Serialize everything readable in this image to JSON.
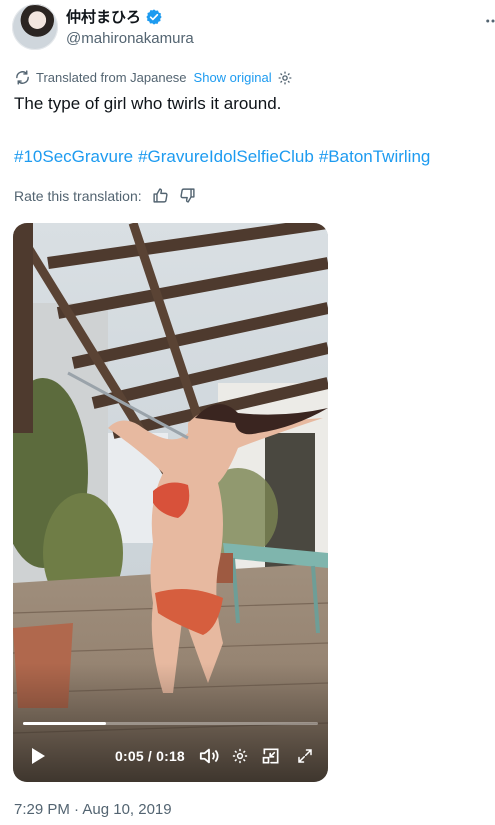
{
  "author": {
    "display_name": "仲村まひろ",
    "handle": "@mahironakamura",
    "verified": true,
    "icons": {
      "verified": "verified-badge-icon",
      "more": "more-dots-icon"
    }
  },
  "translation": {
    "prefix": "Translated from Japanese",
    "show_original": "Show original",
    "icons": {
      "translate": "translate-icon",
      "settings": "gear-icon"
    }
  },
  "tweet": {
    "text": "The type of girl who twirls it around.",
    "hashtags": [
      "#10SecGravure",
      "#GravureIdolSelfieClub",
      "#BatonTwirling"
    ]
  },
  "rating": {
    "label": "Rate this translation:",
    "icons": {
      "up": "thumbs-up-icon",
      "down": "thumbs-down-icon"
    }
  },
  "video": {
    "current_time": "0:05",
    "duration": "0:18",
    "time_display": "0:05 / 0:18",
    "progress_fraction": 0.28,
    "controls": [
      "play-icon",
      "volume-icon",
      "gear-icon",
      "picture-in-picture-icon",
      "fullscreen-icon"
    ]
  },
  "timestamp": "7:29 PM · Aug 10, 2019",
  "colors": {
    "link_blue": "#1d9bf0",
    "secondary_text": "#536471",
    "primary_text": "#0f1419"
  }
}
